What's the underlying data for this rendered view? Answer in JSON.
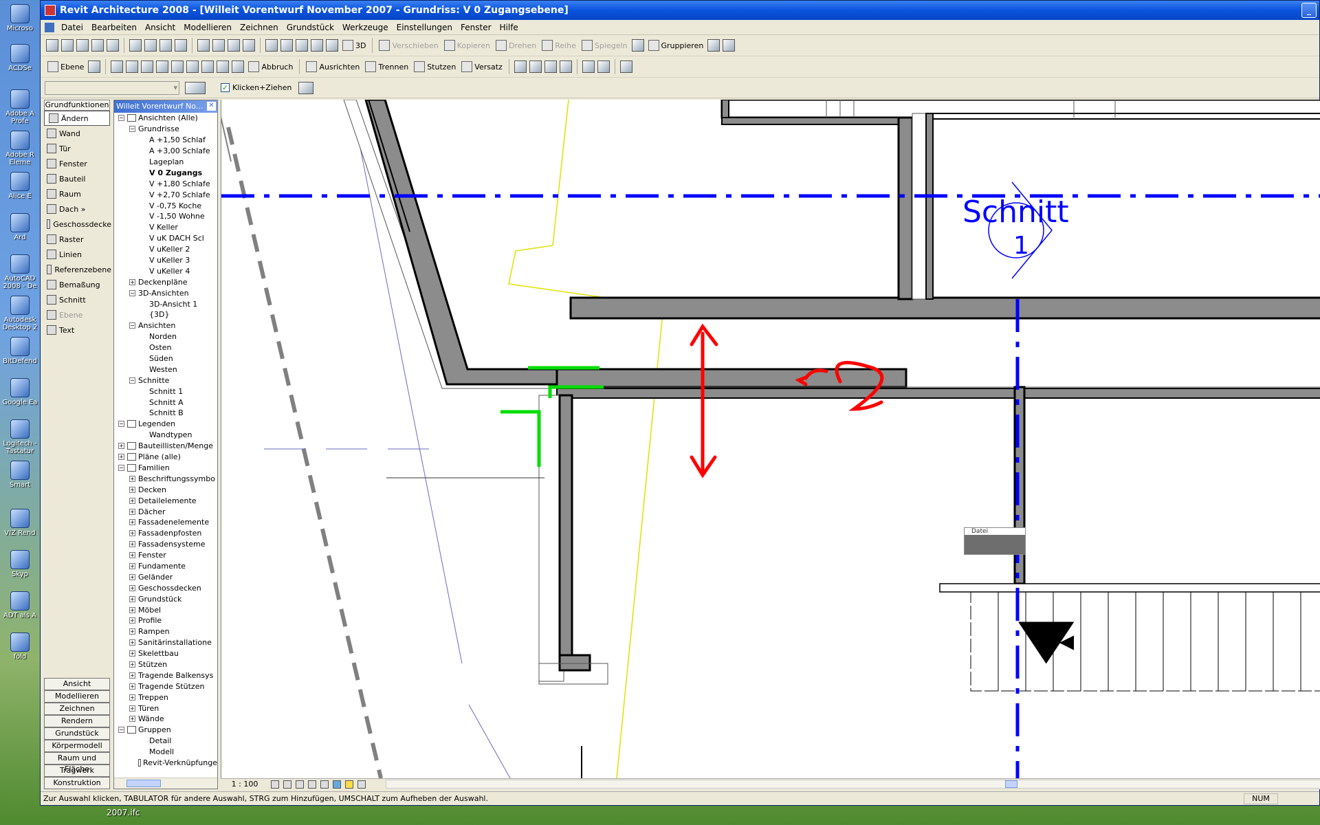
{
  "desktop": {
    "icons": [
      "Microso",
      "ACDSe",
      "Adobe A Profe",
      "Adobe R Eleme",
      "Alice E",
      "Ard",
      "AutoCAD 2008 - De",
      "Autodesk Desktop 2",
      "BitDefend",
      "Google Ea",
      "Logitech -Tastatur",
      "Smart",
      "VIZ Rend",
      "Skyp",
      "ADT als A",
      "fold"
    ],
    "bottom_label": "2007.ifc"
  },
  "window": {
    "title": "Revit Architecture 2008 - [Willeit Vorentwurf November 2007 - Grundriss: V 0 Zugangsebene]"
  },
  "menu": [
    "Datei",
    "Bearbeiten",
    "Ansicht",
    "Modellieren",
    "Zeichnen",
    "Grundstück",
    "Werkzeuge",
    "Einstellungen",
    "Fenster",
    "Hilfe"
  ],
  "toolbar1": {
    "labels": {
      "3d": "3D",
      "verschieben": "Verschieben",
      "kopieren": "Kopieren",
      "drehen": "Drehen",
      "reihe": "Reihe",
      "spiegeln": "Spiegeln",
      "gruppieren": "Gruppieren"
    }
  },
  "toolbar2": {
    "labels": {
      "ebene": "Ebene",
      "abbruch": "Abbruch",
      "ausrichten": "Ausrichten",
      "trennen": "Trennen",
      "stutzen": "Stutzen",
      "versatz": "Versatz"
    }
  },
  "optionsbar": {
    "checkbox_label": "Klicken+Ziehen",
    "checked": true
  },
  "designbar": {
    "header": "Grundfunktionen",
    "items": [
      {
        "label": "Ändern",
        "active": true,
        "disabled": false
      },
      {
        "label": "Wand",
        "active": false,
        "disabled": false
      },
      {
        "label": "Tür",
        "active": false,
        "disabled": false
      },
      {
        "label": "Fenster",
        "active": false,
        "disabled": false
      },
      {
        "label": "Bauteil",
        "active": false,
        "disabled": false
      },
      {
        "label": "Raum",
        "active": false,
        "disabled": false
      },
      {
        "label": "Dach »",
        "active": false,
        "disabled": false
      },
      {
        "label": "Geschossdecke",
        "active": false,
        "disabled": false
      },
      {
        "label": "Raster",
        "active": false,
        "disabled": false
      },
      {
        "label": "Linien",
        "active": false,
        "disabled": false
      },
      {
        "label": "Referenzebene",
        "active": false,
        "disabled": false
      },
      {
        "label": "Bemaßung",
        "active": false,
        "disabled": false
      },
      {
        "label": "Schnitt",
        "active": false,
        "disabled": false
      },
      {
        "label": "Ebene",
        "active": false,
        "disabled": true
      },
      {
        "label": "Text",
        "active": false,
        "disabled": false
      }
    ],
    "tabs": [
      "Ansicht",
      "Modellieren",
      "Zeichnen",
      "Rendern",
      "Grundstück",
      "Körpermodell",
      "Raum und Fläche",
      "Tragwerk",
      "Konstruktion"
    ]
  },
  "browser": {
    "title": "Willeit Vorentwurf No...",
    "tree": [
      {
        "label": "Ansichten (Alle)",
        "level": 0,
        "pm": "−",
        "icon": true
      },
      {
        "label": "Grundrisse",
        "level": 1,
        "pm": "−"
      },
      {
        "label": "A +1,50 Schlaf",
        "level": 2
      },
      {
        "label": "A +3,00 Schlafe",
        "level": 2
      },
      {
        "label": "Lageplan",
        "level": 2
      },
      {
        "label": "V 0 Zugangs",
        "level": 2,
        "bold": true
      },
      {
        "label": "V +1,80 Schlafe",
        "level": 2
      },
      {
        "label": "V +2,70 Schlafe",
        "level": 2
      },
      {
        "label": "V -0,75 Koche",
        "level": 2
      },
      {
        "label": "V -1,50 Wohne",
        "level": 2
      },
      {
        "label": "V Keller",
        "level": 2
      },
      {
        "label": "V uK DACH Scl",
        "level": 2
      },
      {
        "label": "V uKeller 2",
        "level": 2
      },
      {
        "label": "V uKeller 3",
        "level": 2
      },
      {
        "label": "V uKeller 4",
        "level": 2
      },
      {
        "label": "Deckenpläne",
        "level": 1,
        "pm": "+"
      },
      {
        "label": "3D-Ansichten",
        "level": 1,
        "pm": "−"
      },
      {
        "label": "3D-Ansicht 1",
        "level": 2
      },
      {
        "label": "{3D}",
        "level": 2
      },
      {
        "label": "Ansichten",
        "level": 1,
        "pm": "−"
      },
      {
        "label": "Norden",
        "level": 2
      },
      {
        "label": "Osten",
        "level": 2
      },
      {
        "label": "Süden",
        "level": 2
      },
      {
        "label": "Westen",
        "level": 2
      },
      {
        "label": "Schnitte",
        "level": 1,
        "pm": "−"
      },
      {
        "label": "Schnitt 1",
        "level": 2
      },
      {
        "label": "Schnitt A",
        "level": 2
      },
      {
        "label": "Schnitt B",
        "level": 2
      },
      {
        "label": "Legenden",
        "level": 0,
        "pm": "−",
        "icon": true
      },
      {
        "label": "Wandtypen",
        "level": 2
      },
      {
        "label": "Bauteillisten/Menge",
        "level": 0,
        "pm": "+",
        "icon": true
      },
      {
        "label": "Pläne (alle)",
        "level": 0,
        "pm": "+",
        "icon": true
      },
      {
        "label": "Familien",
        "level": 0,
        "pm": "−",
        "icon": true
      },
      {
        "label": "Beschriftungssymbo",
        "level": 1,
        "pm": "+"
      },
      {
        "label": "Decken",
        "level": 1,
        "pm": "+"
      },
      {
        "label": "Detailelemente",
        "level": 1,
        "pm": "+"
      },
      {
        "label": "Dächer",
        "level": 1,
        "pm": "+"
      },
      {
        "label": "Fassadenelemente",
        "level": 1,
        "pm": "+"
      },
      {
        "label": "Fassadenpfosten",
        "level": 1,
        "pm": "+"
      },
      {
        "label": "Fassadensysteme",
        "level": 1,
        "pm": "+"
      },
      {
        "label": "Fenster",
        "level": 1,
        "pm": "+"
      },
      {
        "label": "Fundamente",
        "level": 1,
        "pm": "+"
      },
      {
        "label": "Geländer",
        "level": 1,
        "pm": "+"
      },
      {
        "label": "Geschossdecken",
        "level": 1,
        "pm": "+"
      },
      {
        "label": "Grundstück",
        "level": 1,
        "pm": "+"
      },
      {
        "label": "Möbel",
        "level": 1,
        "pm": "+"
      },
      {
        "label": "Profile",
        "level": 1,
        "pm": "+"
      },
      {
        "label": "Rampen",
        "level": 1,
        "pm": "+"
      },
      {
        "label": "Sanitärinstallatione",
        "level": 1,
        "pm": "+"
      },
      {
        "label": "Skelettbau",
        "level": 1,
        "pm": "+"
      },
      {
        "label": "Stützen",
        "level": 1,
        "pm": "+"
      },
      {
        "label": "Tragende Balkensys",
        "level": 1,
        "pm": "+"
      },
      {
        "label": "Tragende Stützen",
        "level": 1,
        "pm": "+"
      },
      {
        "label": "Treppen",
        "level": 1,
        "pm": "+"
      },
      {
        "label": "Türen",
        "level": 1,
        "pm": "+"
      },
      {
        "label": "Wände",
        "level": 1,
        "pm": "+"
      },
      {
        "label": "Gruppen",
        "level": 0,
        "pm": "−",
        "icon": true
      },
      {
        "label": "Detail",
        "level": 2
      },
      {
        "label": "Modell",
        "level": 2
      },
      {
        "label": "Revit-Verknüpfunge",
        "level": 1,
        "icon": true
      }
    ]
  },
  "canvas": {
    "section_label": "Schnitt",
    "section_number": "1",
    "tag_label": "Datei",
    "colors": {
      "wall": "#8c8c8c",
      "section_line": "#0000ff",
      "annotation_red": "#ff0000",
      "annotation_green": "#00dd00",
      "property_line": "#e6e600"
    }
  },
  "viewbar": {
    "scale": "1 : 100"
  },
  "status": {
    "text": "Zur Auswahl klicken, TABULATOR für andere Auswahl, STRG zum Hinzufügen, UMSCHALT zum Aufheben der Auswahl.",
    "num": "NUM"
  }
}
